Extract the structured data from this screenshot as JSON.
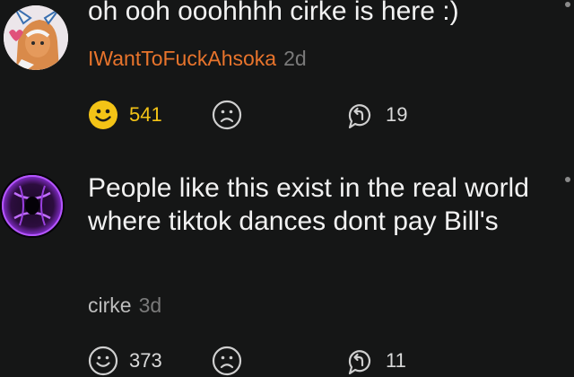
{
  "comments": [
    {
      "text": "oh ooh ooohhhh cirke is here :)",
      "author": "IWantToFuckAhsoka",
      "time": "2d",
      "upvotes": "541",
      "replies": "19",
      "upvoted": true
    },
    {
      "text": "People like this exist in the real world where tiktok dances dont pay Bill's",
      "author": "cirke",
      "time": "3d",
      "upvotes": "373",
      "replies": "11",
      "upvoted": false
    }
  ],
  "icons": {
    "upvote": "smiley-icon",
    "downvote": "frown-icon",
    "reply": "reply-icon"
  },
  "colors": {
    "background": "#151616",
    "op_author": "#e8742c",
    "upvote_active": "#f3c316"
  }
}
